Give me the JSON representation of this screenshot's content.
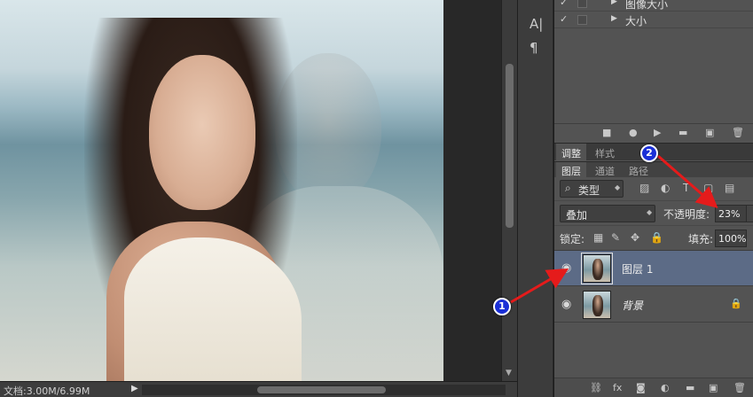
{
  "status_bar": {
    "doc_info": "文档:3.00M/6.99M",
    "arrow": "▶"
  },
  "actions_panel": {
    "rows": [
      {
        "check": "✓",
        "label": "图像大小"
      },
      {
        "check": "✓",
        "label": "大小"
      }
    ]
  },
  "adjust_tabs": {
    "tab1": "调整",
    "tab2": "样式"
  },
  "layers_tabs": {
    "tab1": "图层",
    "tab2": "通道",
    "tab3": "路径"
  },
  "layers_toolbar": {
    "kind": "类型"
  },
  "blend": {
    "mode": "叠加",
    "opacity_label": "不透明度:",
    "opacity_value": "23%"
  },
  "lock": {
    "label": "锁定:",
    "fill_label": "填充:",
    "fill_value": "100%"
  },
  "layers": [
    {
      "name": "图层 1",
      "selected": true
    },
    {
      "name": "背景",
      "selected": false,
      "locked": true
    }
  ],
  "annotations": [
    {
      "number": "1",
      "color": "#1a2fd6",
      "arrow_color": "#e51b1b"
    },
    {
      "number": "2",
      "color": "#1a2fd6",
      "arrow_color": "#e51b1b"
    }
  ],
  "icons": {
    "check": "check-icon",
    "eye": "eye-icon",
    "lock": "lock-icon",
    "search": "search-icon",
    "character": "character-panel-icon",
    "paragraph": "paragraph-panel-icon"
  }
}
